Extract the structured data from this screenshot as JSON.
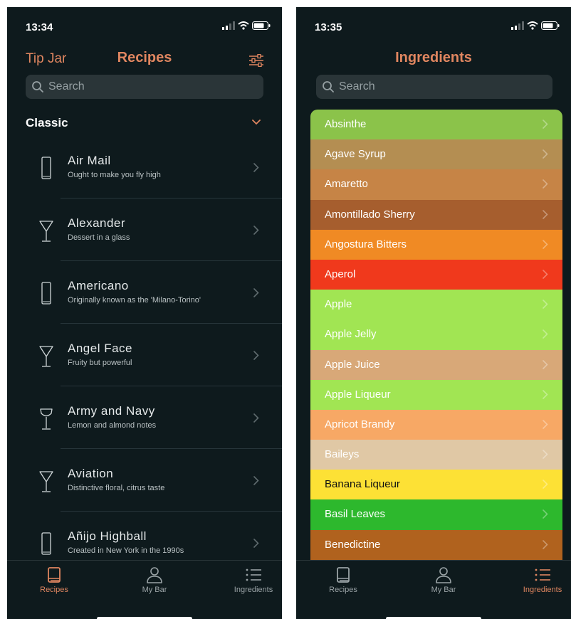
{
  "left_screen": {
    "status": {
      "time": "13:34"
    },
    "nav": {
      "tip_jar": "Tip Jar",
      "title": "Recipes"
    },
    "search": {
      "placeholder": "Search"
    },
    "section": {
      "title": "Classic"
    },
    "recipes": [
      {
        "name": "Air Mail",
        "description": "Ought to make you fly high",
        "glass": "highball"
      },
      {
        "name": "Alexander",
        "description": "Dessert in a glass",
        "glass": "martini"
      },
      {
        "name": "Americano",
        "description": "Originally known as the 'Milano-Torino'",
        "glass": "highball"
      },
      {
        "name": "Angel Face",
        "description": "Fruity but powerful",
        "glass": "martini"
      },
      {
        "name": "Army and Navy",
        "description": "Lemon and almond notes",
        "glass": "coupe"
      },
      {
        "name": "Aviation",
        "description": "Distinctive floral, citrus taste",
        "glass": "martini"
      },
      {
        "name": "Añijo Highball",
        "description": "Created in New York in the 1990s",
        "glass": "highball"
      }
    ],
    "tabs": [
      {
        "label": "Recipes",
        "icon": "book-icon",
        "active": true
      },
      {
        "label": "My Bar",
        "icon": "person-icon",
        "active": false
      },
      {
        "label": "Ingredients",
        "icon": "list-icon",
        "active": false
      }
    ]
  },
  "right_screen": {
    "status": {
      "time": "13:35"
    },
    "nav": {
      "title": "Ingredients"
    },
    "search": {
      "placeholder": "Search"
    },
    "ingredients": [
      {
        "name": "Absinthe",
        "color": "#8bc34a",
        "text_color": "#ffffff"
      },
      {
        "name": "Agave Syrup",
        "color": "#b48e52",
        "text_color": "#ffffff"
      },
      {
        "name": "Amaretto",
        "color": "#c68446",
        "text_color": "#ffffff"
      },
      {
        "name": "Amontillado Sherry",
        "color": "#a65e2e",
        "text_color": "#ffffff"
      },
      {
        "name": "Angostura Bitters",
        "color": "#f08a24",
        "text_color": "#ffffff"
      },
      {
        "name": "Aperol",
        "color": "#f0391c",
        "text_color": "#ffffff"
      },
      {
        "name": "Apple",
        "color": "#a1e553",
        "text_color": "#ffffff"
      },
      {
        "name": "Apple Jelly",
        "color": "#a1e553",
        "text_color": "#ffffff"
      },
      {
        "name": "Apple Juice",
        "color": "#d8a878",
        "text_color": "#ffffff"
      },
      {
        "name": "Apple Liqueur",
        "color": "#a1e553",
        "text_color": "#ffffff"
      },
      {
        "name": "Apricot Brandy",
        "color": "#f7a865",
        "text_color": "#ffffff"
      },
      {
        "name": "Baileys",
        "color": "#e0c8a5",
        "text_color": "#ffffff"
      },
      {
        "name": "Banana Liqueur",
        "color": "#fde135",
        "text_color": "#111111"
      },
      {
        "name": "Basil Leaves",
        "color": "#2db82d",
        "text_color": "#ffffff"
      },
      {
        "name": "Benedictine",
        "color": "#b0621e",
        "text_color": "#ffffff"
      }
    ],
    "tabs": [
      {
        "label": "Recipes",
        "icon": "book-icon",
        "active": false
      },
      {
        "label": "My Bar",
        "icon": "person-icon",
        "active": false
      },
      {
        "label": "Ingredients",
        "icon": "list-icon",
        "active": true
      }
    ]
  },
  "colors": {
    "accent": "#e08660",
    "background": "#0e1a1d",
    "search_bg": "#2a3538",
    "inactive_tab": "#9aa3a6"
  }
}
